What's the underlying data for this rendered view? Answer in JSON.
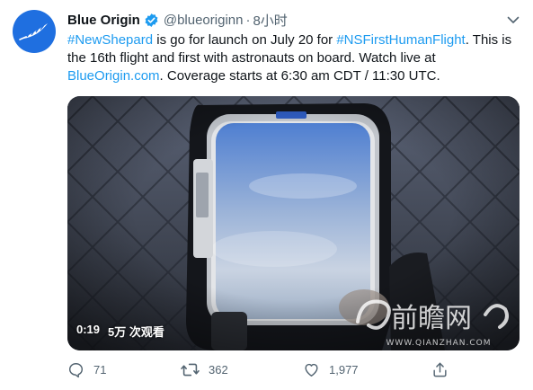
{
  "tweet": {
    "author_name": "Blue Origin",
    "handle": "@blueoriginn",
    "separator": "·",
    "time": "8小时",
    "text": {
      "l1_tag1": "#NewShepard",
      "l1_mid": " is go for launch on July 20 for ",
      "l1_tag2": "#NSFirstHumanFlight",
      "l1_end": ". This is",
      "l2": "the 16th flight and first with astronauts on board. Watch live at",
      "l3_link": "BlueOrigin.com",
      "l3_end": ". Coverage starts at 6:30 am CDT / 11:30 UTC."
    },
    "video": {
      "time": "0:19",
      "views": "5万 次观看"
    },
    "actions": {
      "reply_count": "71",
      "retweet_count": "362",
      "like_count": "1,977"
    }
  },
  "watermark": {
    "text": "前瞻网",
    "url": "WWW.QIANZHAN.COM"
  },
  "colors": {
    "link": "#1d9bf0",
    "verified": "#1d9bf0",
    "avatar_bg": "#1f6fe0",
    "meta_gray": "#536471"
  }
}
